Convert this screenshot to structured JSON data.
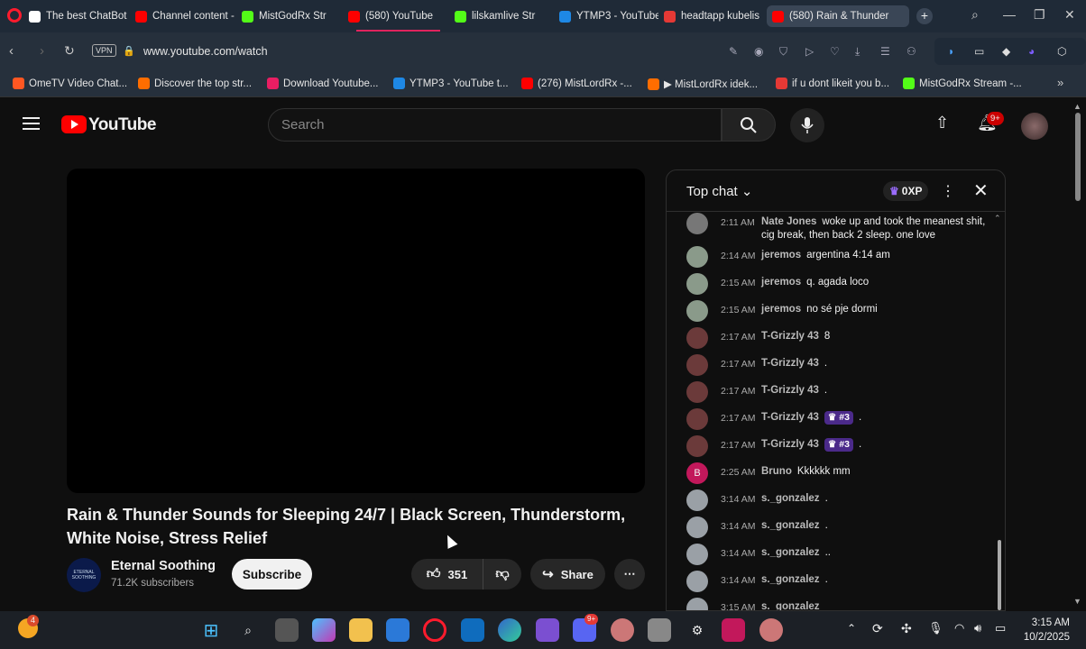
{
  "browser": {
    "tabs": [
      {
        "label": "The best ChatBot",
        "color": "#ffffff"
      },
      {
        "label": "Channel content -",
        "color": "#ff0000"
      },
      {
        "label": "MistGodRx Str",
        "color": "#53fc18"
      },
      {
        "label": "(580) YouTube",
        "color": "#ff0000"
      },
      {
        "label": "lilskamlive Str",
        "color": "#53fc18"
      },
      {
        "label": "YTMP3 - YouTube",
        "color": "#1e88e5"
      },
      {
        "label": "headtapp kubelis",
        "color": "#e53935"
      },
      {
        "label": "(580) Rain & Thunder",
        "color": "#ff0000"
      }
    ],
    "address": {
      "url": "www.youtube.com/watch",
      "vpn_label": "VPN"
    },
    "bookmarks": [
      {
        "label": "OmeTV Video Chat...",
        "color": "#ff5722"
      },
      {
        "label": "Discover the top str...",
        "color": "#ff6d00"
      },
      {
        "label": "Download Youtube...",
        "color": "#e91e63"
      },
      {
        "label": "YTMP3 - YouTube t...",
        "color": "#1e88e5"
      },
      {
        "label": "(276) MistLordRx -...",
        "color": "#ff0000"
      },
      {
        "label": "▶ MistLordRx idek...",
        "color": "#ff6d00"
      },
      {
        "label": "if u dont likeit you b...",
        "color": "#e53935"
      },
      {
        "label": "MistGodRx Stream -...",
        "color": "#53fc18"
      }
    ]
  },
  "youtube": {
    "logo_text": "YouTube",
    "search_placeholder": "Search",
    "notif_count": "9+"
  },
  "video": {
    "title": "Rain & Thunder Sounds for Sleeping 24/7 | Black Screen, Thunderstorm, White Noise, Stress Relief",
    "channel": "Eternal Soothing",
    "channel_avatar_text": "ETERNAL SOOTHING",
    "subscribers": "71.2K subscribers",
    "subscribe_label": "Subscribe",
    "likes": "351",
    "share_label": "Share"
  },
  "chat": {
    "title": "Top chat",
    "xp_label": "0XP",
    "messages": [
      {
        "time": "2:11 AM",
        "author": "Nate Jones",
        "text": "woke up and took the meanest shit, cig break, then back 2 sleep. one love",
        "badge": "",
        "avatar_color": "#777777"
      },
      {
        "time": "2:14 AM",
        "author": "jeremos",
        "text": "argentina 4:14 am",
        "badge": "",
        "avatar_color": "#8a9a8a"
      },
      {
        "time": "2:15 AM",
        "author": "jeremos",
        "text": "q. agada loco",
        "badge": "",
        "avatar_color": "#8a9a8a"
      },
      {
        "time": "2:15 AM",
        "author": "jeremos",
        "text": "no sé pje dormi",
        "badge": "",
        "avatar_color": "#8a9a8a"
      },
      {
        "time": "2:17 AM",
        "author": "T-Grizzly 43",
        "text": "8",
        "badge": "",
        "avatar_color": "#6b3a3a"
      },
      {
        "time": "2:17 AM",
        "author": "T-Grizzly 43",
        "text": ".",
        "badge": "",
        "avatar_color": "#6b3a3a"
      },
      {
        "time": "2:17 AM",
        "author": "T-Grizzly 43",
        "text": ".",
        "badge": "",
        "avatar_color": "#6b3a3a"
      },
      {
        "time": "2:17 AM",
        "author": "T-Grizzly 43",
        "text": ".",
        "badge": "#3",
        "avatar_color": "#6b3a3a"
      },
      {
        "time": "2:17 AM",
        "author": "T-Grizzly 43",
        "text": ".",
        "badge": "#3",
        "avatar_color": "#6b3a3a"
      },
      {
        "time": "2:25 AM",
        "author": "Bruno",
        "text": "Kkkkkk mm",
        "badge": "",
        "avatar_color": "#c2185b",
        "avatar_letter": "B"
      },
      {
        "time": "3:14 AM",
        "author": "s._gonzalez",
        "text": ".",
        "badge": "",
        "avatar_color": "#9aa0a6"
      },
      {
        "time": "3:14 AM",
        "author": "s._gonzalez",
        "text": ".",
        "badge": "",
        "avatar_color": "#9aa0a6"
      },
      {
        "time": "3:14 AM",
        "author": "s._gonzalez",
        "text": "..",
        "badge": "",
        "avatar_color": "#9aa0a6"
      },
      {
        "time": "3:14 AM",
        "author": "s._gonzalez",
        "text": ".",
        "badge": "",
        "avatar_color": "#9aa0a6"
      },
      {
        "time": "3:15 AM",
        "author": "s._gonzalez",
        "text": "",
        "badge": "",
        "avatar_color": "#9aa0a6"
      }
    ]
  },
  "taskbar": {
    "clock_time": "3:15 AM",
    "clock_date": "10/2/2025",
    "weather_badge": "4",
    "discord_badge": "9+"
  }
}
